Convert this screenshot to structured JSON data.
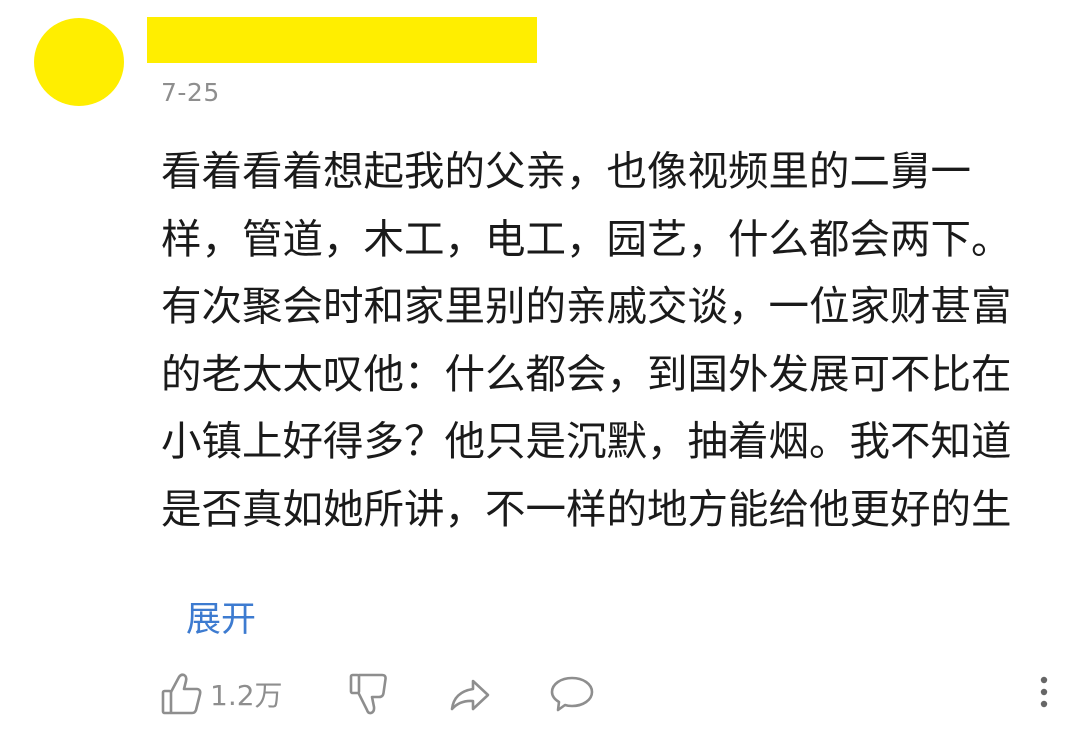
{
  "comment": {
    "date": "7-25",
    "text": "看着看着想起我的父亲，也像视频里的二舅一\n样，管道，木工，电工，园艺，什么都会两下。\n有次聚会时和家里别的亲戚交谈，一位家财甚富\n的老太太叹他：什么都会，到国外发展可不比在\n小镇上好得多？他只是沉默，抽着烟。我不知道\n是否真如她所讲，不一样的地方能给他更好的生",
    "expand_label": "展开"
  },
  "actions": {
    "like_count": "1.2万",
    "like_icon": "thumbs-up-icon",
    "dislike_icon": "thumbs-down-icon",
    "share_icon": "share-arrow-icon",
    "comment_icon": "speech-bubble-icon",
    "more_icon": "vertical-dots-icon"
  },
  "colors": {
    "redaction": "#ffee00",
    "link": "#3d7bd0",
    "muted": "#8e8e8e",
    "text": "#1a1a1a"
  }
}
